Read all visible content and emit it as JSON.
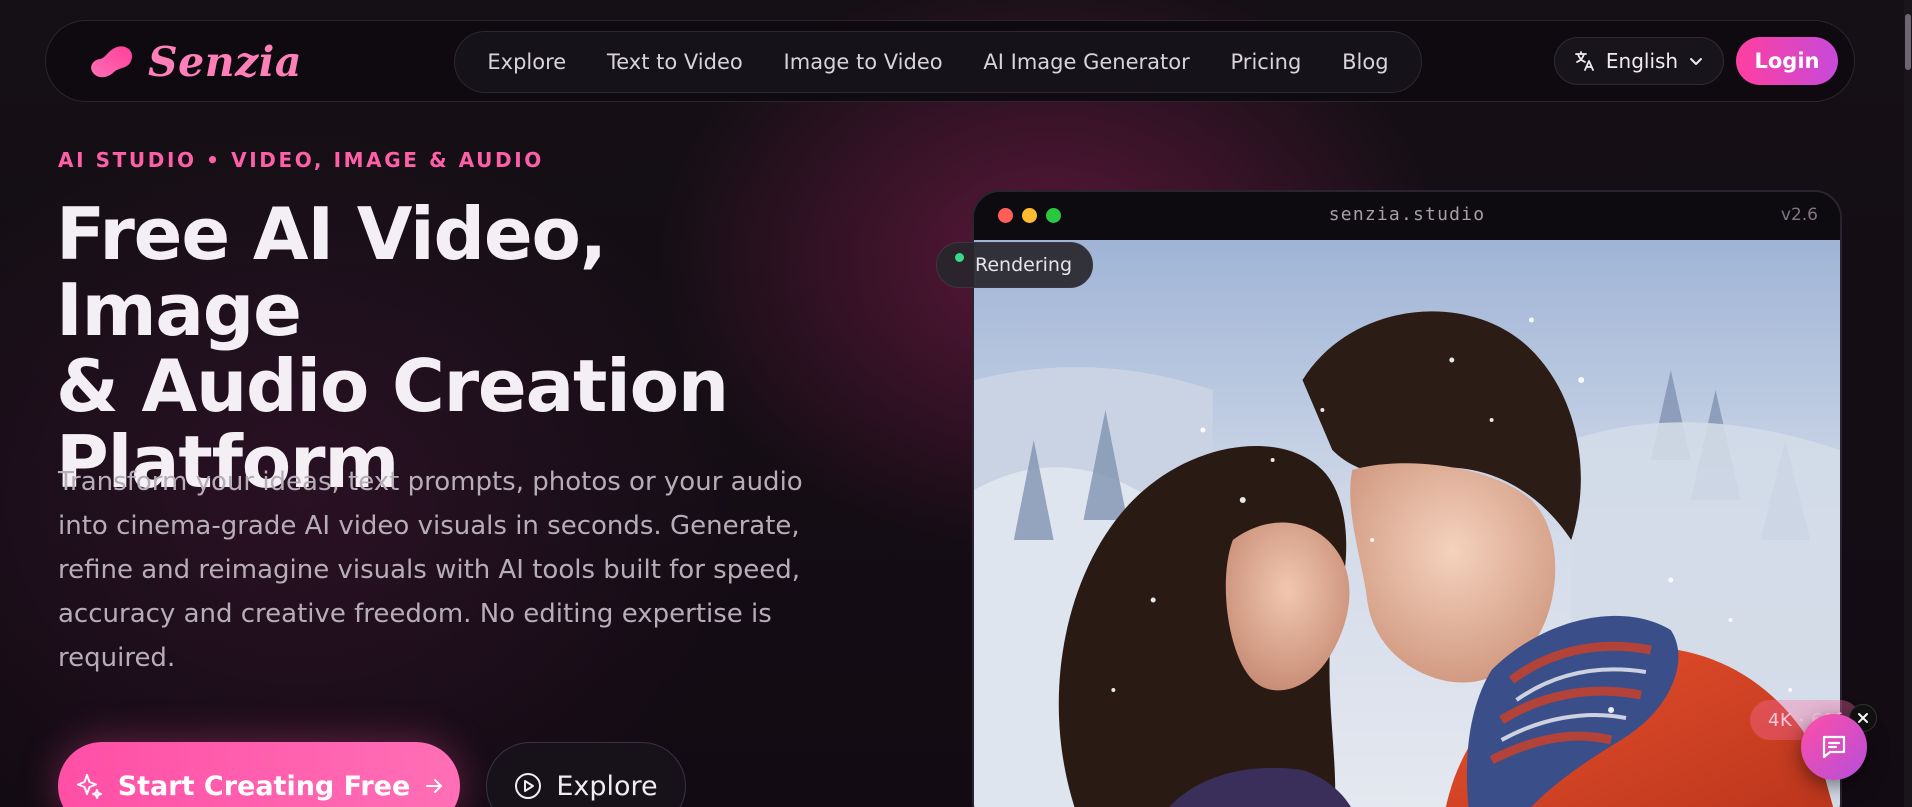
{
  "brand": {
    "name": "Senzia",
    "accent": "#ff5fa8",
    "gradient_end": "#c64ad9"
  },
  "nav": {
    "links": [
      "Explore",
      "Text to Video",
      "Image to Video",
      "AI Image Generator",
      "Pricing",
      "Blog"
    ],
    "language": "English",
    "login_label": "Login"
  },
  "hero": {
    "eyebrow": "AI STUDIO • VIDEO, IMAGE & AUDIO",
    "title_lines": [
      "Free AI Video, Image",
      "& Audio Creation",
      "Platform"
    ],
    "description": "Transform your ideas, text prompts, photos or your audio into cinema-grade AI video visuals in seconds. Generate, refine and reimagine visuals with AI tools built for speed, accuracy and creative freedom. No editing expertise is required.",
    "cta_label": "Start Creating Free",
    "explore_label": "Explore"
  },
  "preview": {
    "url": "senzia.studio",
    "version": "v2.6",
    "status": "Rendering",
    "badge": "4K · 60f",
    "image_alt": "couple-kissing-in-snow"
  },
  "icons": {
    "language": "translate-icon",
    "chevron": "chevron-down-icon",
    "sparkle": "sparkle-icon",
    "arrow": "arrow-right-icon",
    "play": "play-circle-icon",
    "close": "close-icon",
    "chat": "chat-icon"
  }
}
